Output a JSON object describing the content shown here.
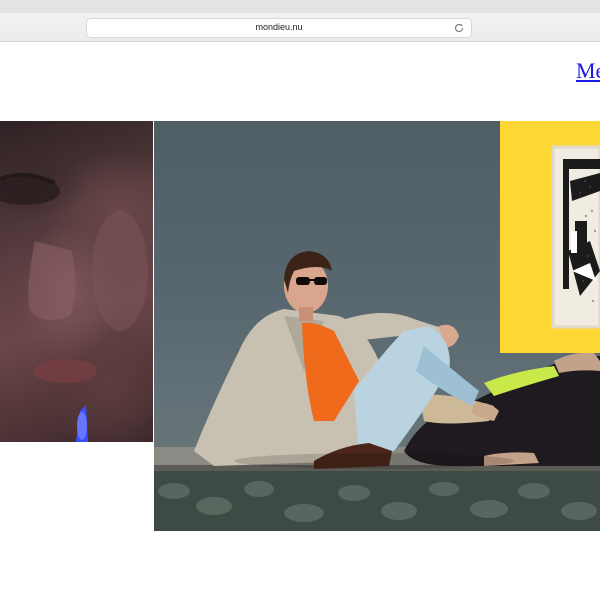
{
  "browser": {
    "url": "mondieu.nu",
    "reload_icon": "reload-icon"
  },
  "nav": {
    "menu_label": "Me"
  },
  "gallery": {
    "images": [
      {
        "subject": "faces-closeup",
        "icon": "photo"
      },
      {
        "subject": "fashion-photo",
        "icon": "photo"
      },
      {
        "subject": "yellow-artwork",
        "icon": "photo"
      }
    ]
  },
  "colors": {
    "link": "#1a1ae6",
    "art_background": "#fdd835",
    "chrome": "#ececec"
  }
}
